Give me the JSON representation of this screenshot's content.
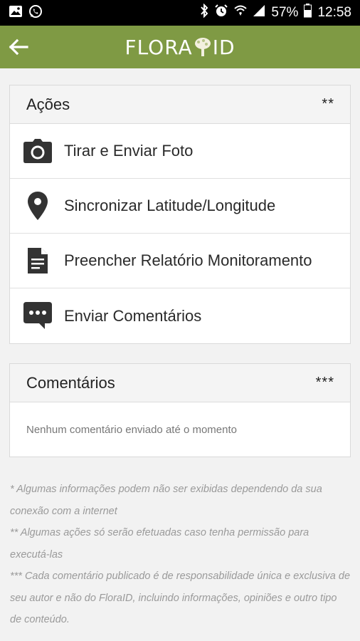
{
  "status_bar": {
    "battery": "57%",
    "time": "12:58"
  },
  "app_bar": {
    "logo_left": "FLORA",
    "logo_right": "ID"
  },
  "actions_card": {
    "title": "Ações",
    "marker": "**",
    "items": [
      {
        "label": "Tirar e Enviar Foto",
        "icon": "camera-icon"
      },
      {
        "label": "Sincronizar Latitude/Longitude",
        "icon": "location-pin-icon"
      },
      {
        "label": "Preencher Relatório Monitoramento",
        "icon": "document-icon"
      },
      {
        "label": "Enviar Comentários",
        "icon": "chat-bubble-icon"
      }
    ]
  },
  "comments_card": {
    "title": "Comentários",
    "marker": "***",
    "empty_message": "Nenhum comentário enviado até o momento"
  },
  "footnotes": [
    "* Algumas informações podem não ser exibidas dependendo da sua conexão com a internet",
    "** Algumas ações só serão efetuadas caso tenha permissão para executá-las",
    "*** Cada comentário publicado é de responsabilidade única e exclusiva de seu autor e não do FloraID, incluindo informações, opiniões e outro tipo de conteúdo."
  ],
  "colors": {
    "app_bar": "#7f9a44",
    "status_bar": "#000000",
    "background": "#f2f2f2"
  }
}
